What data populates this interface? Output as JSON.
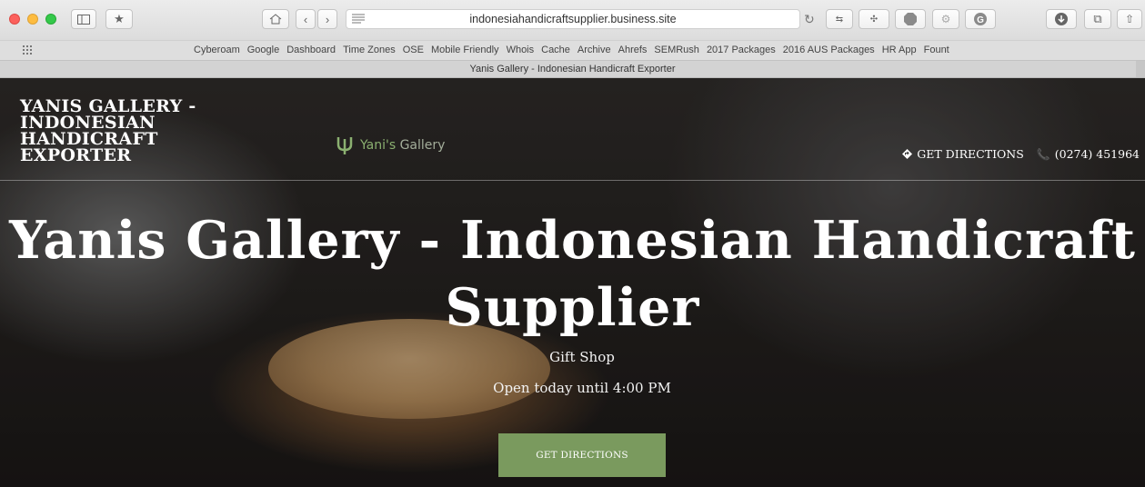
{
  "browser": {
    "url": "indonesiahandicraftsupplier.business.site",
    "tab_title": "Yanis Gallery - Indonesian Handicraft Exporter",
    "bookmarks": [
      "Cyberoam",
      "Google",
      "Dashboard",
      "Time Zones",
      "OSE",
      "Mobile Friendly",
      "Whois",
      "Cache",
      "Archive",
      "Ahrefs",
      "SEMRush",
      "2017 Packages",
      "2016 AUS Packages",
      "HR App",
      "Fount"
    ]
  },
  "site": {
    "title": "YANIS GALLERY - INDONESIAN HANDICRAFT EXPORTER",
    "logo_text_green": "Yani's",
    "logo_text_grey": "Gallery",
    "nav": {
      "directions": "GET DIRECTIONS",
      "phone": "(0274) 451964"
    }
  },
  "hero": {
    "heading": "Yanis Gallery - Indonesian Handicraft Supplier",
    "category": "Gift Shop",
    "hours": "Open today until 4:00 PM",
    "cta": "GET DIRECTIONS"
  },
  "colors": {
    "accent_green": "#7a9a5e",
    "logo_green": "#8bb070"
  }
}
